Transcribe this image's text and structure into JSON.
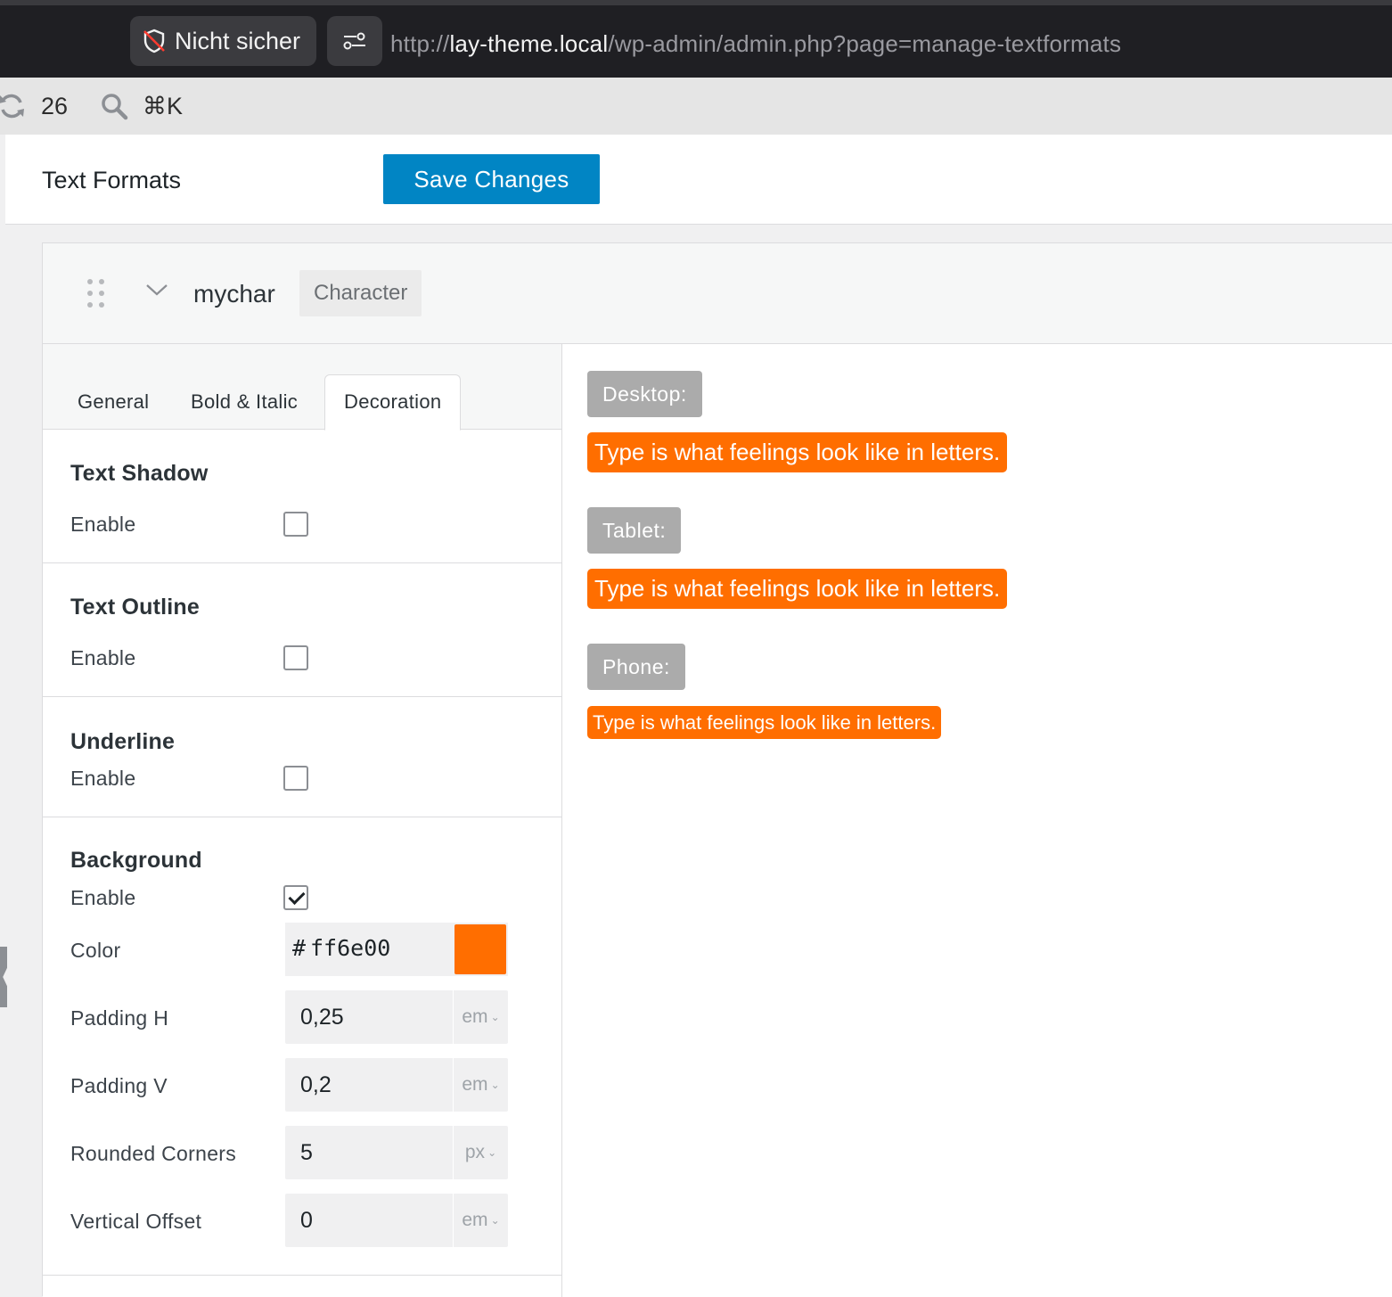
{
  "browser": {
    "security_label": "Nicht sicher",
    "url_scheme": "http://",
    "url_host": "lay-theme.local",
    "url_path": "/wp-admin/admin.php?page=manage-textformats"
  },
  "toolbar": {
    "updates_count": "26",
    "search_shortcut": "⌘K"
  },
  "header": {
    "title": "Text Formats",
    "save_label": "Save Changes"
  },
  "format": {
    "name": "mychar",
    "type": "Character"
  },
  "tabs": [
    {
      "label": "General",
      "active": false
    },
    {
      "label": "Bold & Italic",
      "active": false
    },
    {
      "label": "Decoration",
      "active": true
    }
  ],
  "sections": {
    "text_shadow": {
      "title": "Text Shadow",
      "enable_label": "Enable",
      "enabled": false
    },
    "text_outline": {
      "title": "Text Outline",
      "enable_label": "Enable",
      "enabled": false
    },
    "underline": {
      "title": "Underline",
      "enable_label": "Enable",
      "enabled": false
    },
    "background": {
      "title": "Background",
      "enable_label": "Enable",
      "enabled": true,
      "color_label": "Color",
      "color_hash": "#",
      "color_value": "ff6e00",
      "color_hex": "#ff6e00",
      "padding_h": {
        "label": "Padding H",
        "value": "0,25",
        "unit": "em"
      },
      "padding_v": {
        "label": "Padding V",
        "value": "0,2",
        "unit": "em"
      },
      "rounded_corners": {
        "label": "Rounded Corners",
        "value": "5",
        "unit": "px"
      },
      "vertical_offset": {
        "label": "Vertical Offset",
        "value": "0",
        "unit": "em"
      }
    }
  },
  "preview": {
    "desktop_label": "Desktop:",
    "tablet_label": "Tablet:",
    "phone_label": "Phone:",
    "sample_text": "Type is what feelings look like in letters."
  },
  "colors": {
    "accent_blue": "#0185c4",
    "highlight_orange": "#ff6e00",
    "device_label_gray": "#ababab"
  }
}
